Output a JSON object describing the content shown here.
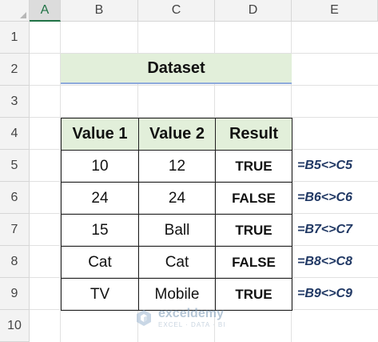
{
  "sheet": {
    "selected_column": "A",
    "columns": [
      "A",
      "B",
      "C",
      "D",
      "E"
    ],
    "rows": [
      "1",
      "2",
      "3",
      "4",
      "5",
      "6",
      "7",
      "8",
      "9",
      "10"
    ]
  },
  "dataset": {
    "title": "Dataset",
    "headers": [
      "Value 1",
      "Value 2",
      "Result"
    ],
    "rows": [
      {
        "value1": "10",
        "value2": "12",
        "result": "TRUE",
        "formula": "=B5<>C5"
      },
      {
        "value1": "24",
        "value2": "24",
        "result": "FALSE",
        "formula": "=B6<>C6"
      },
      {
        "value1": "15",
        "value2": "Ball",
        "result": "TRUE",
        "formula": "=B7<>C7"
      },
      {
        "value1": "Cat",
        "value2": "Cat",
        "result": "FALSE",
        "formula": "=B8<>C8"
      },
      {
        "value1": "TV",
        "value2": "Mobile",
        "result": "TRUE",
        "formula": "=B9<>C9"
      }
    ]
  },
  "watermark": {
    "name": "exceldemy",
    "tagline": "EXCEL · DATA · BI"
  },
  "colors": {
    "header_fill": "#e2efda",
    "formula_text": "#203864",
    "selected_column": "#217346",
    "title_underline": "#8eaadb"
  }
}
